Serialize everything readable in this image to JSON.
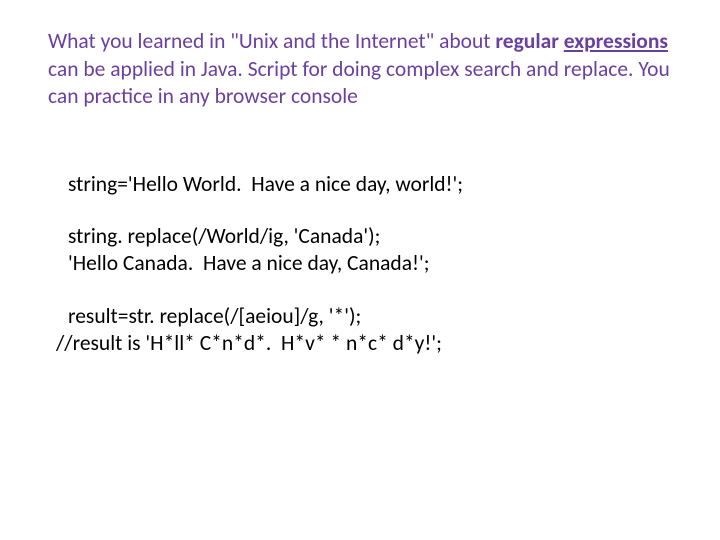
{
  "heading": {
    "part1": "What you learned in \"Unix and the Internet\" about ",
    "bold1": "regular ",
    "bold2_underlined": "expressions",
    "part2": " can be applied in Java. Script for doing complex search and replace.  You can practice in any browser console"
  },
  "code": {
    "l1": "string='Hello World.  Have a nice day, world!';",
    "l2": "string. replace(/World/ig, 'Canada');",
    "l3": "'Hello Canada.  Have a nice day, Canada!';",
    "l4": "result=str. replace(/[aeiou]/g, '*');",
    "l5": "//result is 'H*ll* C*n*d*.  H*v* * n*c* d*y!';"
  }
}
